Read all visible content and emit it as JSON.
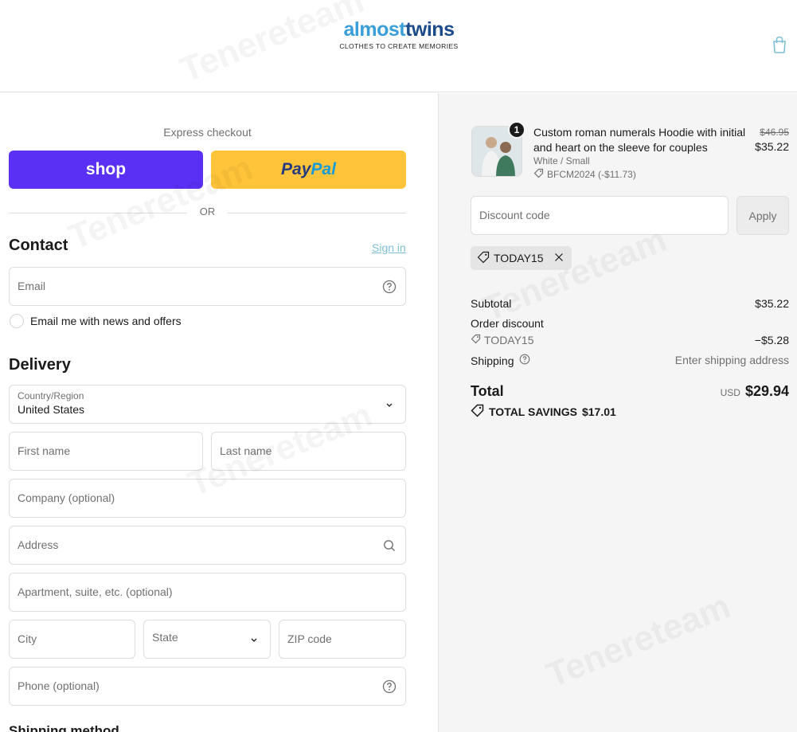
{
  "header": {
    "logo_a": "almost",
    "logo_b": "twins",
    "logo_tagline": "CLOTHES TO CREATE MEMORIES",
    "cart_icon": "shopping-bag-icon"
  },
  "express": {
    "label": "Express checkout",
    "shop_label": "shop",
    "paypal_label_a": "Pay",
    "paypal_label_b": "Pal",
    "or": "OR"
  },
  "contact": {
    "title": "Contact",
    "sign_in": "Sign in",
    "email_placeholder": "Email",
    "newsletter_label": "Email me with news and offers"
  },
  "delivery": {
    "title": "Delivery",
    "country_label": "Country/Region",
    "country_value": "United States",
    "first_name": "First name",
    "last_name": "Last name",
    "company": "Company (optional)",
    "address": "Address",
    "apartment": "Apartment, suite, etc. (optional)",
    "city": "City",
    "state": "State",
    "zip": "ZIP code",
    "phone": "Phone (optional)"
  },
  "shipping_method": {
    "title": "Shipping method"
  },
  "order": {
    "quantity": "1",
    "product_name": "Custom roman numerals Hoodie with initial and heart on the sleeve for couples",
    "variant": "White / Small",
    "product_discount": "BFCM2024 (-$11.73)",
    "old_price": "$46.95",
    "new_price": "$35.22",
    "discount_placeholder": "Discount code",
    "apply": "Apply",
    "applied_code": "TODAY15",
    "subtotal_label": "Subtotal",
    "subtotal_value": "$35.22",
    "order_discount_label": "Order discount",
    "order_discount_code": "TODAY15",
    "order_discount_value": "−$5.28",
    "shipping_label": "Shipping",
    "shipping_value": "Enter shipping address",
    "total_label": "Total",
    "total_currency": "USD",
    "total_value": "$29.94",
    "savings_label": "TOTAL SAVINGS",
    "savings_value": "$17.01"
  },
  "colors": {
    "shop_purple": "#5a31f4",
    "paypal_yellow": "#ffc439",
    "link": "#7fbfd6"
  },
  "watermark": "Tenereteam"
}
